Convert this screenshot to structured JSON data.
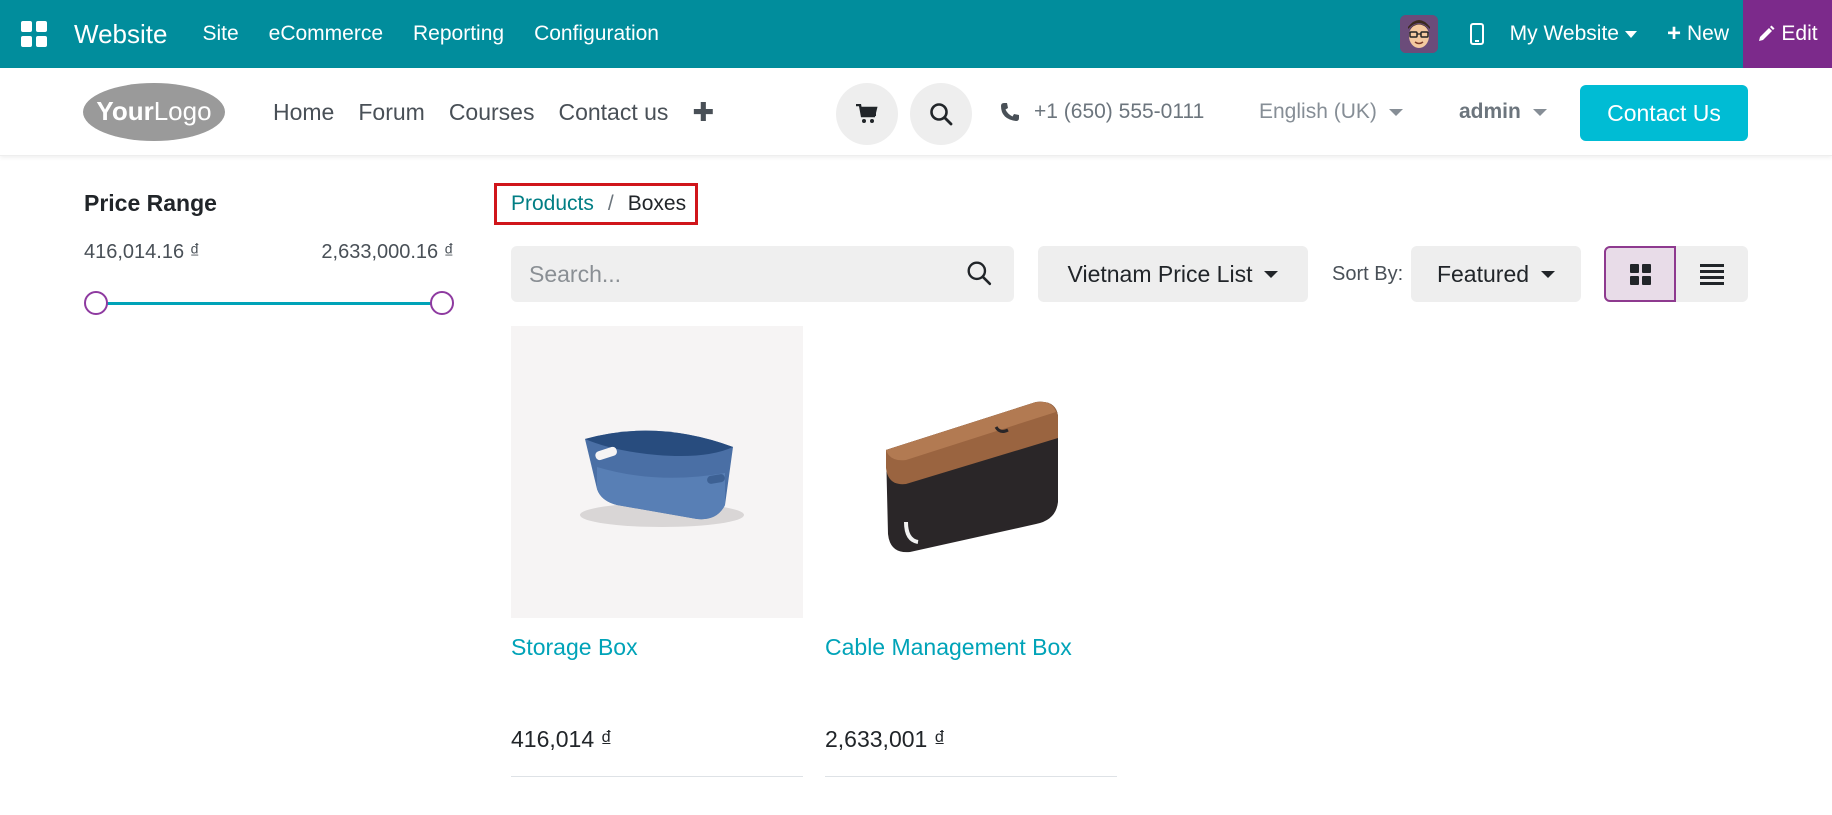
{
  "admin_bar": {
    "title": "Website",
    "menus": [
      "Site",
      "eCommerce",
      "Reporting",
      "Configuration"
    ],
    "website_selector": "My Website",
    "new_label": "New",
    "edit_label": "Edit"
  },
  "header": {
    "logo_text": "YourLogo",
    "nav": [
      "Home",
      "Forum",
      "Courses",
      "Contact us"
    ],
    "phone": "+1 (650) 555-0111",
    "language": "English (UK)",
    "user": "admin",
    "contact_button": "Contact Us"
  },
  "sidebar": {
    "title": "Price Range",
    "min_price": "416,014.16 ₫",
    "max_price": "2,633,000.16 ₫"
  },
  "breadcrumb": {
    "parent": "Products",
    "separator": "/",
    "current": "Boxes"
  },
  "toolbar": {
    "search_placeholder": "Search...",
    "pricelist": "Vietnam Price List",
    "sort_label": "Sort By:",
    "sort_value": "Featured"
  },
  "products": [
    {
      "name": "Storage Box",
      "price": "416,014 ₫"
    },
    {
      "name": "Cable Management Box",
      "price": "2,633,001 ₫"
    }
  ],
  "colors": {
    "admin_bar": "#018d9c",
    "edit_button": "#7c2a8b",
    "contact_button": "#00bcd4",
    "product_link": "#00a3b8",
    "breadcrumb_highlight": "#d0151b"
  }
}
